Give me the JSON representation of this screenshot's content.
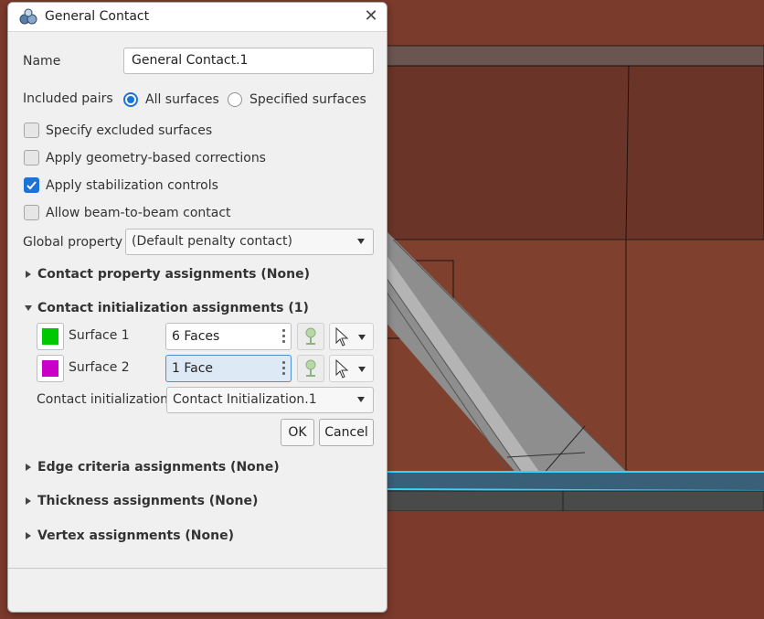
{
  "dialog": {
    "title": "General Contact",
    "title_icon": "contact-icon",
    "close_glyph": "✕"
  },
  "form": {
    "name_label": "Name",
    "name_value": "General Contact.1",
    "included_pairs_label": "Included pairs",
    "included_pairs_options": [
      "All surfaces",
      "Specified surfaces"
    ],
    "included_pairs_selected": "All surfaces",
    "checkboxes": [
      {
        "label": "Specify excluded surfaces",
        "checked": false
      },
      {
        "label": "Apply geometry-based corrections",
        "checked": false
      },
      {
        "label": "Apply stabilization controls",
        "checked": true
      },
      {
        "label": "Allow beam-to-beam contact",
        "checked": false
      }
    ],
    "global_property_label": "Global property",
    "global_property_value": "(Default penalty contact)"
  },
  "sections": {
    "contact_property": "Contact property assignments (None)",
    "contact_init": "Contact initialization assignments (1)",
    "edge_criteria": "Edge criteria assignments (None)",
    "thickness": "Thickness assignments (None)",
    "vertex": "Vertex assignments (None)"
  },
  "contact_init": {
    "surface1": {
      "label": "Surface 1",
      "value": "6 Faces",
      "color": "#00c800"
    },
    "surface2": {
      "label": "Surface 2",
      "value": "1 Face",
      "color": "#c800c8"
    },
    "init_label": "Contact initialization",
    "init_value": "Contact Initialization.1",
    "ok_label": "OK",
    "cancel_label": "Cancel"
  },
  "colors": {
    "accent": "#1a73d9",
    "background_model": "#7a3a2a"
  }
}
